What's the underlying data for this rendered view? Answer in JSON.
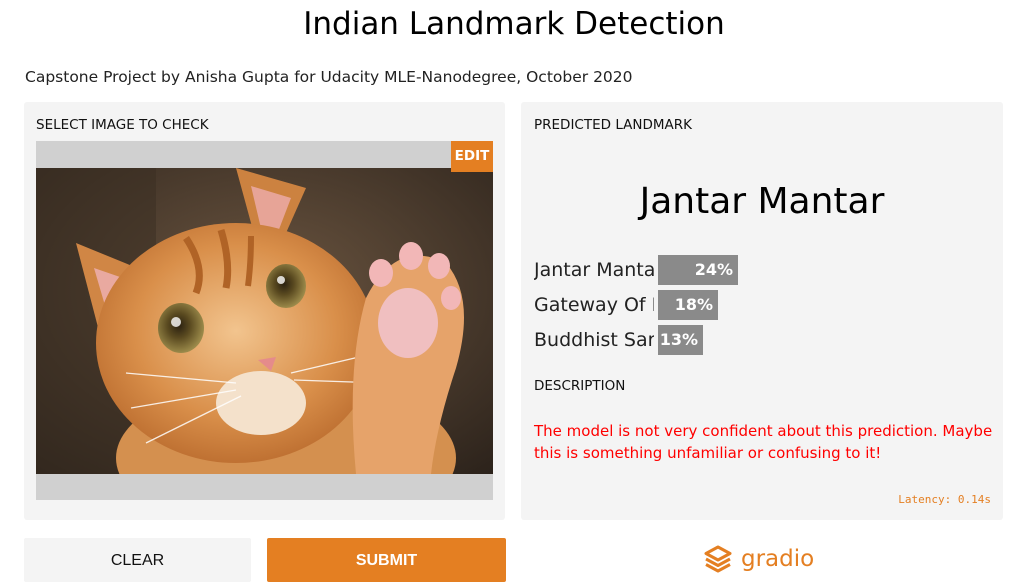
{
  "header": {
    "title": "Indian Landmark Detection",
    "subtitle": "Capstone Project by Anisha Gupta for Udacity MLE-Nanodegree, October 2020"
  },
  "input_panel": {
    "label": "SELECT IMAGE TO CHECK",
    "edit_label": "EDIT"
  },
  "output_panel": {
    "label": "PREDICTED LANDMARK",
    "prediction": "Jantar Mantar",
    "confidences": [
      {
        "label": "Jantar Manta",
        "percent": "24%",
        "value": 0.24
      },
      {
        "label": "Gateway Of I",
        "percent": "18%",
        "value": 0.18
      },
      {
        "label": "Buddhist Sar",
        "percent": "13%",
        "value": 0.13
      }
    ],
    "description_label": "DESCRIPTION",
    "description": "The model is not very confident about this prediction. Maybe this is something unfamiliar or confusing to it!",
    "latency": "Latency: 0.14s"
  },
  "actions": {
    "clear_label": "CLEAR",
    "submit_label": "SUBMIT"
  },
  "footer": {
    "brand": "gradio",
    "brand_icon": "gradio-logo-icon"
  },
  "colors": {
    "accent": "#e47f22",
    "warning_text": "#ff0000",
    "bar": "#8a8a8a"
  }
}
